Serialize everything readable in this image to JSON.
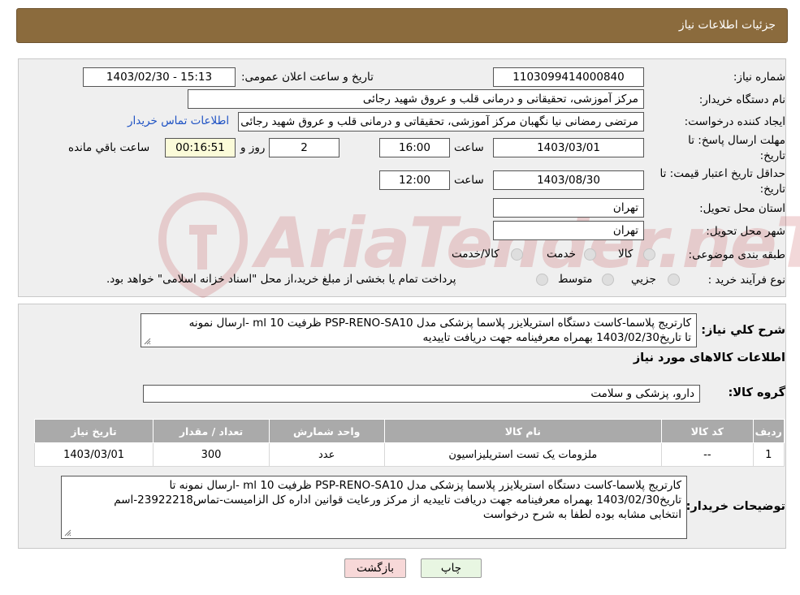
{
  "header": {
    "title": "جزئیات اطلاعات نیاز"
  },
  "form": {
    "need_number_label": "شماره نیاز:",
    "need_number": "1103099414000840",
    "announce_label": "تاریخ و ساعت اعلان عمومی:",
    "announce_value": "1403/02/30 - 15:13",
    "buyer_org_label": "نام دستگاه خریدار:",
    "buyer_org": "مرکز آموزشی، تحقیقاتی و درمانی قلب و عروق شهید رجائی",
    "creator_label": "ایجاد کننده درخواست:",
    "creator": "مرتضی رمضانی نیا نگهبان مرکز آموزشی، تحقیقاتی و درمانی قلب و عروق شهید رجائی",
    "contact_link": "اطلاعات تماس خریدار",
    "deadline_label_1": "مهلت ارسال پاسخ: تا",
    "deadline_label_2": "تاریخ:",
    "deadline_date": "1403/03/01",
    "time_word": "ساعت",
    "deadline_time": "16:00",
    "days_value": "2",
    "days_word": "روز و",
    "remaining_time": "00:16:51",
    "remaining_word": "ساعت باقي مانده",
    "validity_label_1": "حداقل تاریخ اعتبار قیمت: تا",
    "validity_label_2": "تاریخ:",
    "validity_date": "1403/08/30",
    "validity_time": "12:00",
    "province_label": "استان محل تحویل:",
    "province": "تهران",
    "city_label": "شهر محل تحویل:",
    "city": "تهران",
    "category_label": "طبقه بندی موضوعی:",
    "category_options": [
      "کالا",
      "خدمت",
      "کالا/خدمت"
    ],
    "process_label": "نوع فرآیند خرید :",
    "process_options": [
      "جزیي",
      "متوسط"
    ],
    "process_note": "پرداخت تمام یا بخشی از مبلغ خرید،از محل \"اسناد خزانه اسلامی\" خواهد بود."
  },
  "details": {
    "summary_label": "شرح کلي نیاز:",
    "summary_line1": "کارتریج پلاسما-کاست دستگاه استریلایزر پلاسما پزشکی مدل PSP-RENO-SA10 ظرفیت 10 ml -ارسال نمونه",
    "summary_line2": "تا تاریخ1403/02/30 بهمراه معرفینامه جهت دریافت تاییدیه",
    "items_title": "اطلاعات کالاهای مورد نیاز",
    "group_label": "گروه کالا:",
    "group_value": "دارو، پزشکی و سلامت",
    "table": {
      "headers": [
        "ردیف",
        "کد کالا",
        "نام کالا",
        "واحد شمارش",
        "تعداد / مقدار",
        "تاریخ نیاز"
      ],
      "rows": [
        [
          "1",
          "--",
          "ملزومات یک تست استریلیزاسیون",
          "عدد",
          "300",
          "1403/03/01"
        ]
      ]
    },
    "buyer_notes_label": "توضیحات خریدار:",
    "notes_line1": "کارتریج پلاسما-کاست دستگاه استریلایزر پلاسما پزشکی مدل PSP-RENO-SA10 ظرفیت 10 ml -ارسال نمونه تا",
    "notes_line2": "تاریخ1403/02/30 بهمراه معرفینامه جهت دریافت تاییدیه از مرکز ورعایت قوانین اداره کل الزامیست-تماس23922218-اسم",
    "notes_line3": "انتخابی مشابه بوده لطفا به شرح درخواست"
  },
  "buttons": {
    "print": "چاپ",
    "back": "بازگشت"
  },
  "watermark": "AriaTender.neT",
  "colors": {
    "header": "#8b6b3d",
    "table_header": "#aaaaaa",
    "back_button": "#f7d8d8",
    "print_button": "#e8f6e2",
    "link": "#1e52c4"
  }
}
